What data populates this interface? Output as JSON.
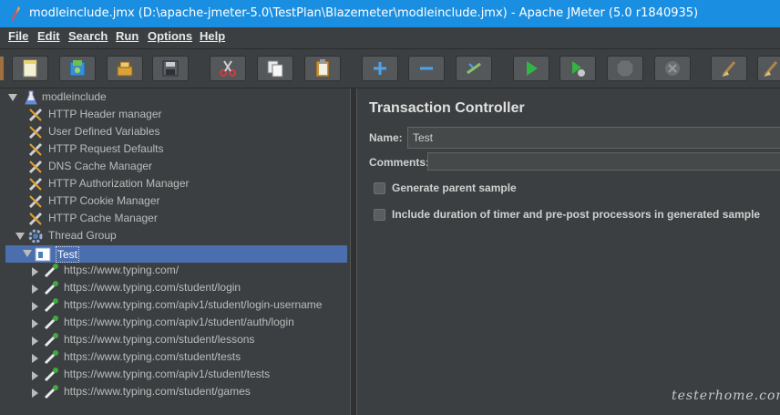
{
  "window": {
    "title": "modleinclude.jmx (D:\\apache-jmeter-5.0\\TestPlan\\Blazemeter\\modleinclude.jmx) - Apache JMeter (5.0 r1840935)"
  },
  "menu": [
    "File",
    "Edit",
    "Search",
    "Run",
    "Options",
    "Help"
  ],
  "toolbar": {
    "buttons": [
      "new-icon",
      "templates-icon",
      "open-icon",
      "save-icon",
      "cut-icon",
      "copy-icon",
      "paste-icon",
      "expand-icon",
      "collapse-icon",
      "toggle-icon",
      "start-icon",
      "start-no-pause-icon",
      "stop-icon",
      "shutdown-icon",
      "clear-icon",
      "clear-all-icon"
    ]
  },
  "tree": {
    "root": "modleinclude",
    "config_elements": [
      "HTTP Header manager",
      "User Defined Variables",
      "HTTP Request Defaults",
      "DNS Cache Manager",
      "HTTP Authorization Manager",
      "HTTP Cookie Manager",
      "HTTP Cache Manager"
    ],
    "thread_group": "Thread Group",
    "controller": "Test",
    "samplers": [
      "https://www.typing.com/",
      "https://www.typing.com/student/login",
      "https://www.typing.com/apiv1/student/login-username",
      "https://www.typing.com/apiv1/student/auth/login",
      "https://www.typing.com/student/lessons",
      "https://www.typing.com/student/tests",
      "https://www.typing.com/apiv1/student/tests",
      "https://www.typing.com/student/games"
    ]
  },
  "panel": {
    "title": "Transaction Controller",
    "name_label": "Name:",
    "name_value": "Test",
    "comments_label": "Comments:",
    "comments_value": "",
    "checkbox1": "Generate parent sample",
    "checkbox2": "Include duration of timer and pre-post processors in generated sample"
  },
  "watermark": "testerhome.com"
}
